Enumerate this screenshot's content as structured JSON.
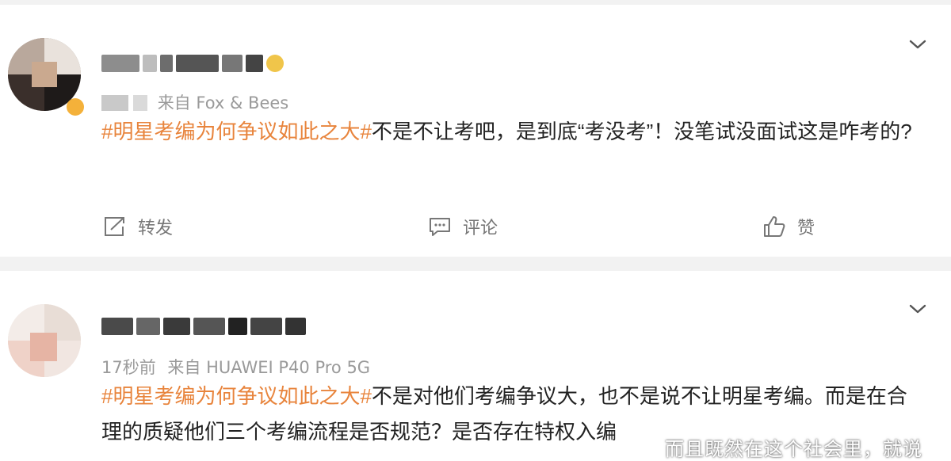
{
  "posts": [
    {
      "source_prefix": "来自",
      "source_device": "Fox & Bees",
      "timestamp": "",
      "topic": "#明星考编为何争议如此之大#",
      "text": "不是不让考吧，是到底“考没考”！没笔试没面试这是咋考的?",
      "actions": {
        "repost_label": "转发",
        "comment_label": "评论",
        "like_label": "赞"
      }
    },
    {
      "source_prefix": "来自",
      "source_device": "HUAWEI P40 Pro 5G",
      "timestamp": "17秒前",
      "topic": "#明星考编为何争议如此之大#",
      "text": "不是对他们考编争议大，也不是说不让明星考编。而是在合理的质疑他们三个考编流程是否规范？是否存在特权入编"
    }
  ],
  "watermark": "而且既然在这个社会里，就说",
  "icons": {
    "more": "chevron-down-icon",
    "repost": "repost-icon",
    "comment": "comment-icon",
    "like": "thumbs-up-icon"
  },
  "colors": {
    "topic": "#e8843c",
    "background": "#f2f2f2",
    "card": "#ffffff",
    "meta": "#9a9a9a"
  }
}
